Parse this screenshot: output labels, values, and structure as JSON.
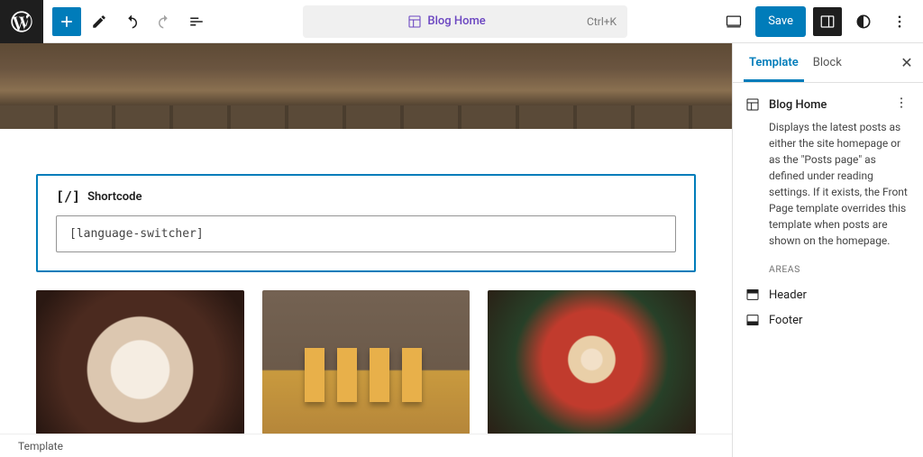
{
  "toolbar": {
    "document_title": "Blog Home",
    "kbd_shortcut": "Ctrl+K",
    "save_label": "Save"
  },
  "editor": {
    "shortcode": {
      "block_title": "Shortcode",
      "value": "[language-switcher]"
    }
  },
  "breadcrumb": "Template",
  "sidebar": {
    "tabs": {
      "template": "Template",
      "block": "Block"
    },
    "panel_title": "Blog Home",
    "description": "Displays the latest posts as either the site homepage or as the \"Posts page\" as defined under reading settings. If it exists, the Front Page template overrides this template when posts are shown on the homepage.",
    "areas_label": "AREAS",
    "areas": [
      {
        "label": "Header"
      },
      {
        "label": "Footer"
      }
    ]
  }
}
